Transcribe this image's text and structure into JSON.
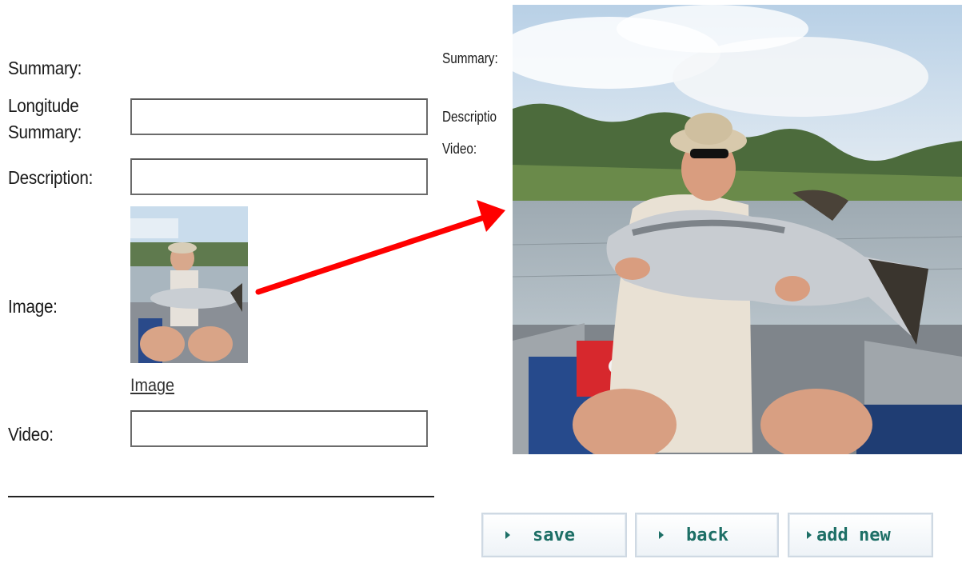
{
  "form": {
    "summary_label": "Summary:",
    "longitude_label_line1": "Longitude",
    "longitude_label_line2": "Summary:",
    "longitude_value": "",
    "description_label": "Description:",
    "description_value": "",
    "image_label": "Image:",
    "image_link": "Image",
    "video_label": "Video:",
    "video_value": ""
  },
  "overlay_form": {
    "summary_label": "Summary:",
    "description_label": "Descriptio",
    "video_label": "Video:"
  },
  "buttons": {
    "save": "save",
    "back": "back",
    "add_new": "add new"
  },
  "colors": {
    "arrow": "#ff0000",
    "button_text": "#1d6f66"
  }
}
